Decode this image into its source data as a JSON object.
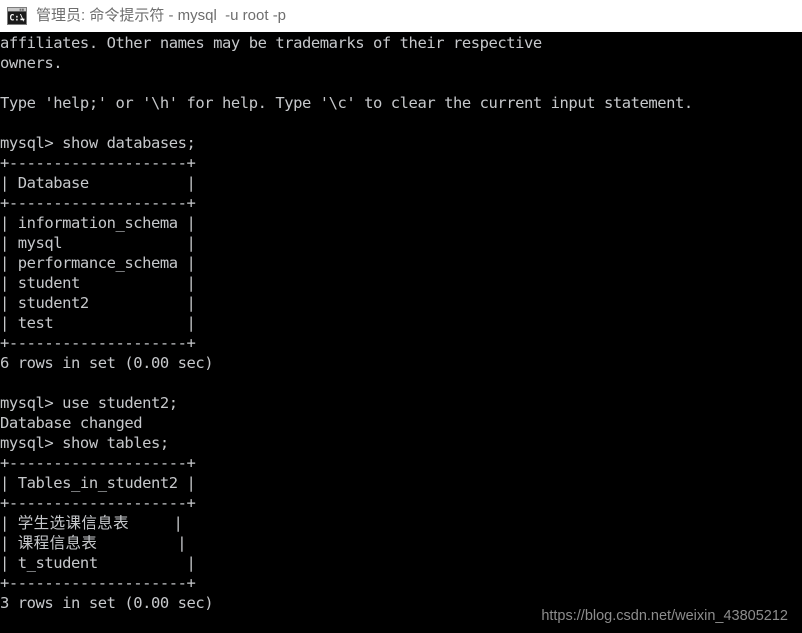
{
  "window": {
    "title": "管理员: 命令提示符 - mysql  -u root -p",
    "icon": "cmd-console-icon",
    "titlebar_bg": "#ffffff",
    "titlebar_text_color": "#6e6e6e",
    "console_bg": "#000000",
    "console_text_color": "#c6c8cb"
  },
  "console": {
    "lines": [
      "affiliates. Other names may be trademarks of their respective",
      "owners.",
      "",
      "Type 'help;' or '\\h' for help. Type '\\c' to clear the current input statement.",
      "",
      "mysql> show databases;",
      "+--------------------+",
      "| Database           |",
      "+--------------------+",
      "| information_schema |",
      "| mysql              |",
      "| performance_schema |",
      "| student            |",
      "| student2           |",
      "| test               |",
      "+--------------------+",
      "6 rows in set (0.00 sec)",
      "",
      "mysql> use student2;",
      "Database changed",
      "mysql> show tables;",
      "+--------------------+",
      "| Tables_in_student2 |",
      "+--------------------+",
      "| 学生选课信息表     |",
      "| 课程信息表         |",
      "| t_student          |",
      "+--------------------+",
      "3 rows in set (0.00 sec)"
    ],
    "prompt": "mysql>",
    "commands": [
      "show databases;",
      "use student2;",
      "show tables;"
    ],
    "databases_result": {
      "column_header": "Database",
      "rows": [
        "information_schema",
        "mysql",
        "performance_schema",
        "student",
        "student2",
        "test"
      ],
      "footer": "6 rows in set (0.00 sec)"
    },
    "use_result": "Database changed",
    "tables_result": {
      "column_header": "Tables_in_student2",
      "rows": [
        "学生选课信息表",
        "课程信息表",
        "t_student"
      ],
      "footer": "3 rows in set (0.00 sec)"
    }
  },
  "watermark": {
    "text": "https://blog.csdn.net/weixin_43805212"
  }
}
